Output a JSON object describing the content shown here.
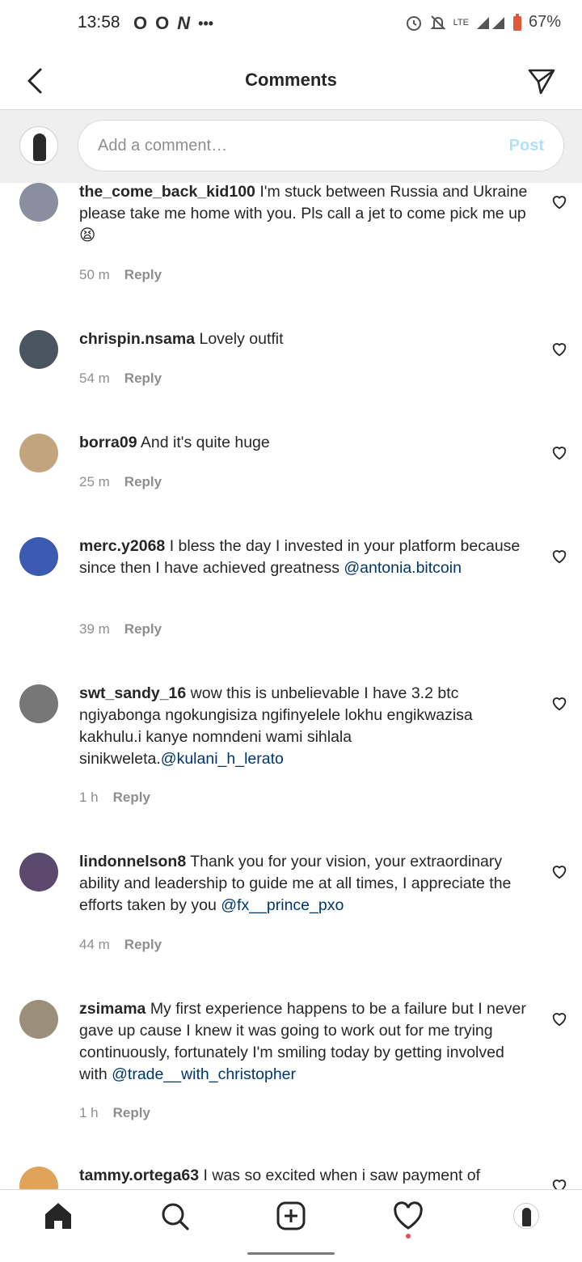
{
  "status_bar": {
    "time": "13:58",
    "notif_icons": [
      "O",
      "O",
      "N",
      "•••"
    ],
    "lte": "LTE",
    "battery": "67%"
  },
  "header": {
    "title": "Comments"
  },
  "composer": {
    "placeholder": "Add a comment…",
    "post_label": "Post"
  },
  "comments": [
    {
      "username": "the_come_back_kid100",
      "text": "I'm stuck between Russia and Ukraine please take me home with you. Pls call a jet to come pick me up 😫",
      "mention": "",
      "time": "50 m",
      "reply": "Reply",
      "avatar_color": "#8a8fa0"
    },
    {
      "username": "chrispin.nsama",
      "text": "Lovely outfit",
      "mention": "",
      "time": "54 m",
      "reply": "Reply",
      "avatar_color": "#4a5560"
    },
    {
      "username": "borra09",
      "text": "And it's quite huge",
      "mention": "",
      "time": "25 m",
      "reply": "Reply",
      "avatar_color": "#c2a57e"
    },
    {
      "username": "merc.y2068",
      "text": "I bless the day I invested in your platform because since then I have achieved greatness",
      "mention": "@antonia.bitcoin",
      "time": "39 m",
      "reply": "Reply",
      "avatar_color": "#3a5bb0"
    },
    {
      "username": "swt_sandy_16",
      "text": "wow this is unbelievable I have 3.2 btc ngiyabonga ngokungisiza ngifinyelele lokhu engikwazisa kakhulu.i kanye nomndeni wami sihlala sinikweleta.",
      "mention": "@kulani_h_lerato",
      "time": "1 h",
      "reply": "Reply",
      "avatar_color": "#777777"
    },
    {
      "username": "lindonnelson8",
      "text": "Thank you for your vision, your extraordinary ability and leadership to guide me at all times, I appreciate the efforts taken by you",
      "mention": "@fx__prince_pxo",
      "time": "44 m",
      "reply": "Reply",
      "avatar_color": "#5b4a6e"
    },
    {
      "username": "zsimama",
      "text": "My first experience happens to be a failure but I never gave up cause I knew it was going to work out for me trying continuously, fortunately I'm smiling today by getting involved with",
      "mention": "@trade__with_christopher",
      "time": "1 h",
      "reply": "Reply",
      "avatar_color": "#9c8f7a"
    },
    {
      "username": "tammy.ortega63",
      "text": "I was so excited when i saw payment of",
      "mention": "",
      "time": "",
      "reply": "",
      "avatar_color": "#e0a35a"
    }
  ],
  "icons": {
    "back": "chevron-left-icon",
    "share": "send-icon",
    "like": "heart-outline-icon",
    "nav": [
      "home-icon",
      "search-icon",
      "create-icon",
      "activity-icon",
      "profile-avatar"
    ]
  }
}
